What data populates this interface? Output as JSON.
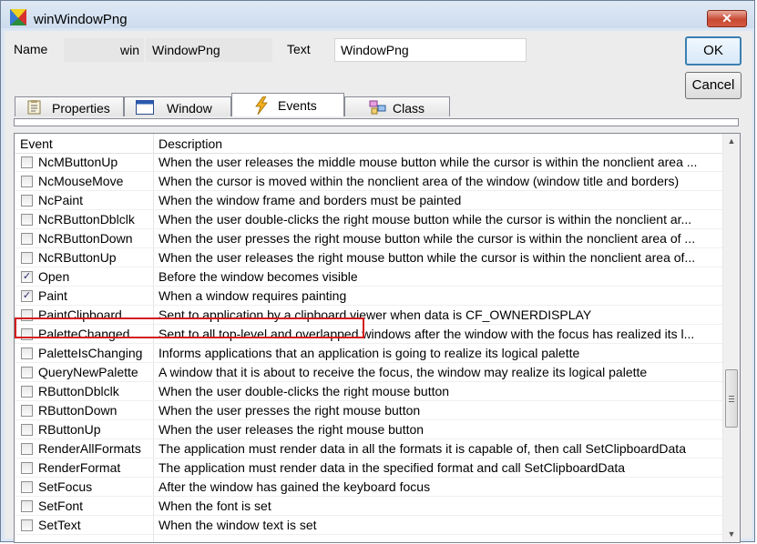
{
  "window": {
    "title": "winWindowPng",
    "close_label": "✕",
    "icon": "app-window-icon"
  },
  "form": {
    "name_label": "Name",
    "name_prefix": "win",
    "name_value": "WindowPng",
    "text_label": "Text",
    "text_value": "WindowPng"
  },
  "buttons": {
    "ok": "OK",
    "cancel": "Cancel"
  },
  "tabs": [
    {
      "label": "Properties",
      "icon": "properties-icon"
    },
    {
      "label": "Window",
      "icon": "window-icon"
    },
    {
      "label": "Events",
      "icon": "lightning-icon",
      "active": true
    },
    {
      "label": "Class",
      "icon": "class-icon"
    }
  ],
  "grid": {
    "headers": [
      "Event",
      "Description"
    ],
    "rows": [
      {
        "event": "NcMButtonUp",
        "description": "When the user releases the middle mouse button while the cursor is within the nonclient area ...",
        "checked": false
      },
      {
        "event": "NcMouseMove",
        "description": "When the cursor is moved within the nonclient area of the window (window title and borders)",
        "checked": false
      },
      {
        "event": "NcPaint",
        "description": "When the window frame and borders must be painted",
        "checked": false
      },
      {
        "event": "NcRButtonDblclk",
        "description": "When the user double-clicks the right mouse button while the cursor is within the nonclient ar...",
        "checked": false
      },
      {
        "event": "NcRButtonDown",
        "description": "When the user presses the right mouse button while the cursor is within the nonclient area of ...",
        "checked": false
      },
      {
        "event": "NcRButtonUp",
        "description": "When the user releases the right mouse button while the cursor is within the nonclient area of...",
        "checked": false
      },
      {
        "event": "Open",
        "description": "Before the window becomes visible",
        "checked": true
      },
      {
        "event": "Paint",
        "description": "When a window requires painting",
        "checked": true,
        "highlighted": true
      },
      {
        "event": "PaintClipboard",
        "description": "Sent to application by a clipboard viewer when data is CF_OWNERDISPLAY",
        "checked": false
      },
      {
        "event": "PaletteChanged",
        "description": "Sent to all top-level and overlapped windows after the window with the focus has realized its l...",
        "checked": false
      },
      {
        "event": "PaletteIsChanging",
        "description": "Informs applications that an application is going to realize its logical palette",
        "checked": false
      },
      {
        "event": "QueryNewPalette",
        "description": "A window that it is about to receive the focus, the window may realize its logical palette",
        "checked": false
      },
      {
        "event": "RButtonDblclk",
        "description": "When the user double-clicks the right mouse button",
        "checked": false
      },
      {
        "event": "RButtonDown",
        "description": "When the user presses the right mouse button",
        "checked": false
      },
      {
        "event": "RButtonUp",
        "description": "When the user releases the right mouse button",
        "checked": false
      },
      {
        "event": "RenderAllFormats",
        "description": "The application must render data in all the formats it is capable of, then call SetClipboardData",
        "checked": false
      },
      {
        "event": "RenderFormat",
        "description": "The application must render data in the specified format and call SetClipboardData",
        "checked": false
      },
      {
        "event": "SetFocus",
        "description": "After the window has gained the keyboard focus",
        "checked": false
      },
      {
        "event": "SetFont",
        "description": "When the font is set",
        "checked": false
      },
      {
        "event": "SetText",
        "description": "When the window text is set",
        "checked": false
      }
    ]
  },
  "colors": {
    "highlight_border": "#d41c1c",
    "default_button_border": "#3c7fb1"
  }
}
